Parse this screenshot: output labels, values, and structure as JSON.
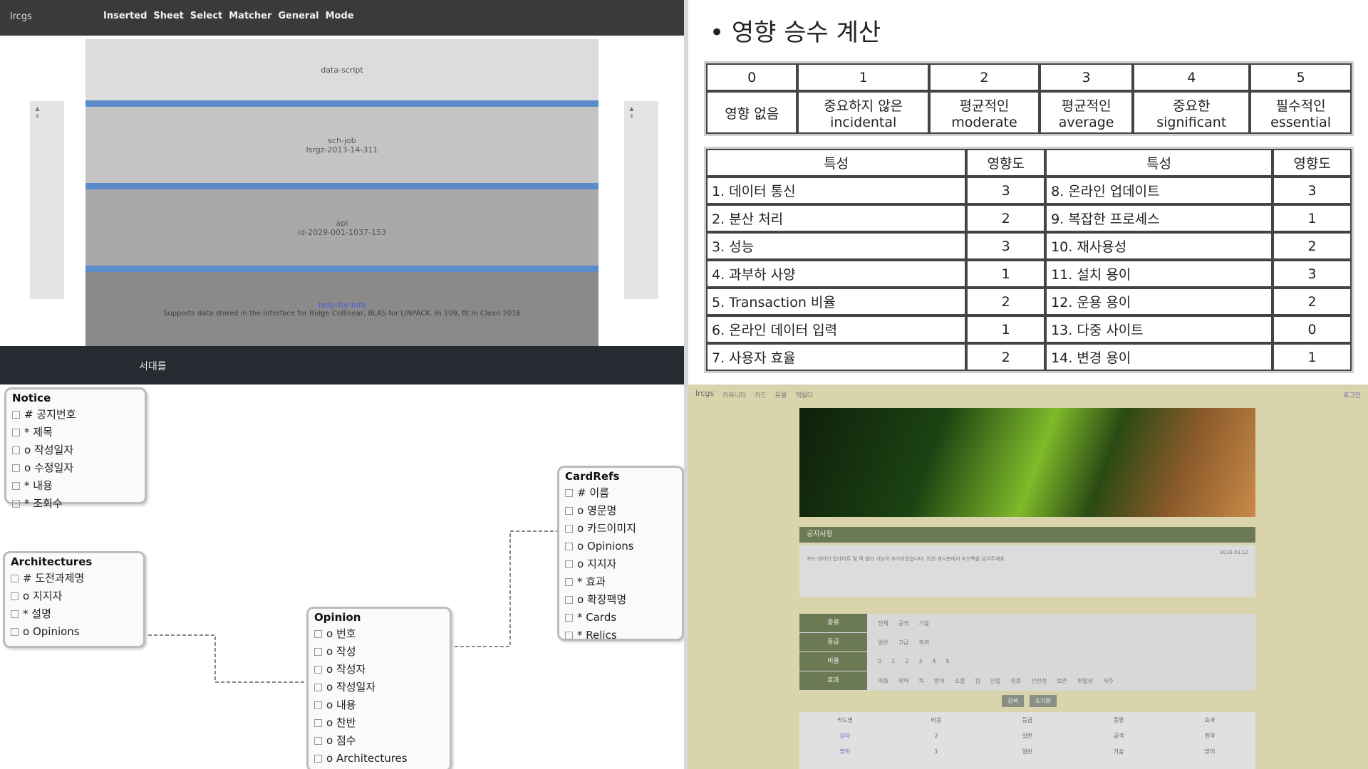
{
  "app": {
    "brand": "lrcgs",
    "nav": [
      "Inserted",
      "Sheet",
      "Select",
      "Matcher",
      "General",
      "Mode"
    ],
    "sidebar_left_text": "▲ ≡",
    "sidebar_right_text": "▲ ≡",
    "layers": [
      {
        "line1": "data-script",
        "line2": ""
      },
      {
        "line1": "sch-job",
        "line2": "lsrgz-2013-14-311"
      },
      {
        "line1": "api",
        "line2": "id-2029-001-1037-153"
      },
      {
        "line1": "help-for-info",
        "line2": "Supports data stored in the interface for Ridge Collinear, BLAS for LINPACK. In 109, fit in Clean 2016"
      }
    ],
    "bottom_label": "서대를"
  },
  "doc": {
    "title": "• 영향 승수 계산",
    "scale": {
      "header": [
        "0",
        "1",
        "2",
        "3",
        "4",
        "5"
      ],
      "row": [
        [
          "영향 없음",
          ""
        ],
        [
          "중요하지 않은",
          "incidental"
        ],
        [
          "평균적인",
          "moderate"
        ],
        [
          "평균적인",
          "average"
        ],
        [
          "중요한",
          "significant"
        ],
        [
          "필수적인",
          "essential"
        ]
      ]
    },
    "factors": {
      "header": [
        "특성",
        "영향도",
        "특성",
        "영향도"
      ],
      "rows": [
        [
          "1. 데이터 통신",
          "3",
          "8. 온라인 업데이트",
          "3"
        ],
        [
          "2. 분산 처리",
          "2",
          "9. 복잡한 프로세스",
          "1"
        ],
        [
          "3. 성능",
          "3",
          "10. 재사용성",
          "2"
        ],
        [
          "4. 과부하 사양",
          "1",
          "11. 설치 용이",
          "3"
        ],
        [
          "5. Transaction 비율",
          "2",
          "12. 운용 용이",
          "2"
        ],
        [
          "6. 온라인 데이터 입력",
          "1",
          "13. 다중 사이트",
          "0"
        ],
        [
          "7. 사용자 효율",
          "2",
          "14. 변경 용이",
          "1"
        ]
      ]
    }
  },
  "er": {
    "entities": [
      {
        "name": "Notice",
        "fields": [
          "# 공지번호",
          "* 제목",
          "o 작성일자",
          "o 수정일자",
          "* 내용",
          "* 조회수"
        ]
      },
      {
        "name": "Architectures",
        "fields": [
          "# 도전과제명",
          "o 지지자",
          "* 설명",
          "o Opinions"
        ]
      },
      {
        "name": "Opinion",
        "fields": [
          "o 번호",
          "o 작성",
          "o 작성자",
          "o 작성일자",
          "o 내용",
          "o 찬반",
          "o 점수",
          "o Architectures"
        ]
      },
      {
        "name": "CardRefs",
        "fields": [
          "# 이름",
          "o 영문명",
          "o 카드이미지",
          "o Opinions",
          "o 지지자",
          "* 효과",
          "o 확장팩명",
          "* Cards",
          "* Relics"
        ]
      }
    ]
  },
  "game": {
    "brand": "lrcgs",
    "topnav": [
      "커뮤니티",
      "카드",
      "유물",
      "덱빌더"
    ],
    "login": "로그인",
    "news_head": "공지사항",
    "news_meta": "2016.03.12",
    "news_text": "카드 데이터 업데이트 및 덱 빌더 기능이 추가되었습니다. 의견 게시판에서 피드백을 남겨주세요.",
    "stat_rows": [
      {
        "label": "종류",
        "values": [
          "전체",
          "공격",
          "기술"
        ]
      },
      {
        "label": "등급",
        "values": [
          "일반",
          "고급",
          "희귀"
        ]
      },
      {
        "label": "비용",
        "values": [
          "0",
          "1",
          "2",
          "3",
          "4",
          "5"
        ]
      },
      {
        "label": "효과",
        "values": [
          "약화",
          "취약",
          "독",
          "방어",
          "소멸",
          "힘",
          "민첩",
          "집중",
          "선천성",
          "보존",
          "휘발성",
          "저주"
        ]
      }
    ],
    "pager": [
      "검색",
      "초기화"
    ],
    "table_header": [
      "카드명",
      "비용",
      "등급",
      "종류",
      "효과"
    ],
    "table_rows": [
      [
        "강타",
        "2",
        "일반",
        "공격",
        "취약"
      ],
      [
        "방어",
        "1",
        "일반",
        "기술",
        "방어"
      ]
    ]
  }
}
